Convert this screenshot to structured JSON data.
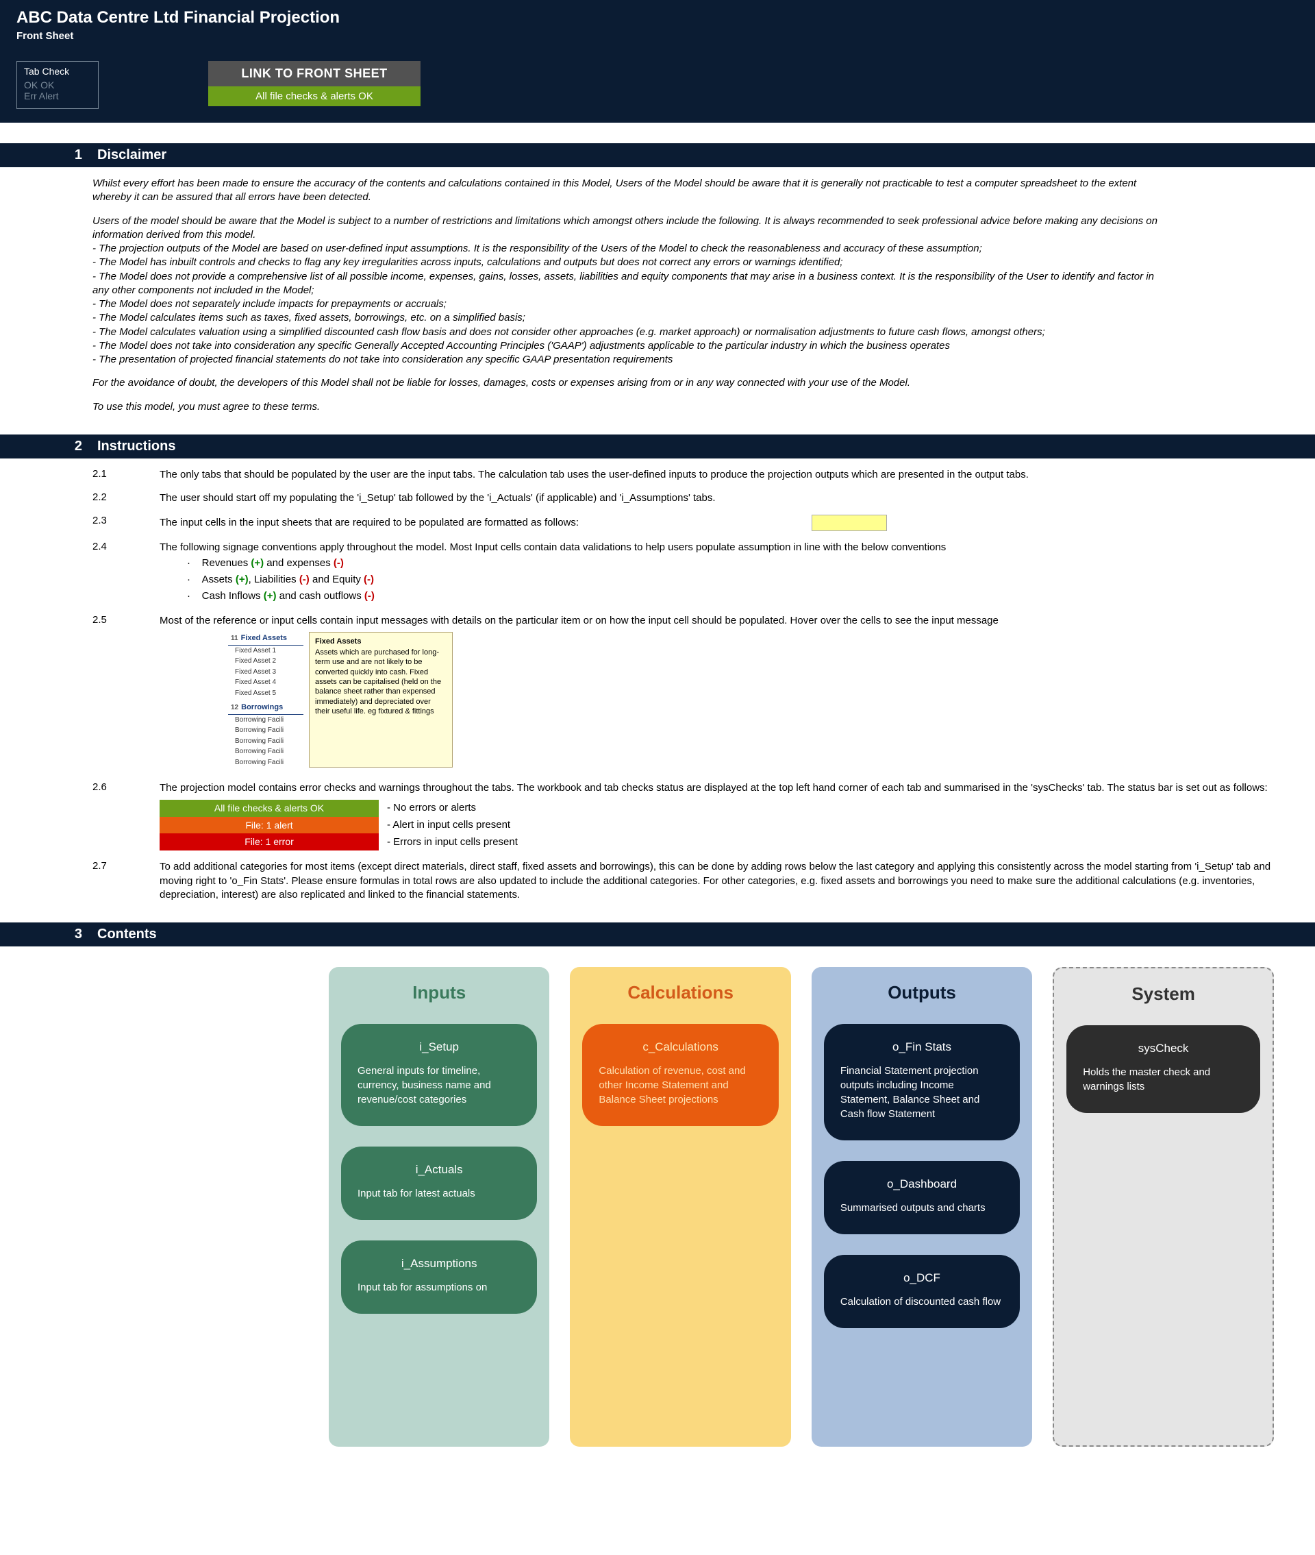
{
  "header": {
    "title": "ABC Data Centre Ltd Financial Projection",
    "subtitle": "Front Sheet",
    "tab_check": {
      "label": "Tab Check",
      "row1": "OK   OK",
      "row2": "Err   Alert"
    },
    "link_button": "LINK TO FRONT SHEET",
    "status_bar": "All file checks & alerts OK"
  },
  "sections": {
    "s1_num": "1",
    "s1_title": "Disclaimer",
    "s2_num": "2",
    "s2_title": "Instructions",
    "s3_num": "3",
    "s3_title": "Contents"
  },
  "disclaimer": {
    "p1": "Whilst every effort has been made to ensure the accuracy of the contents and calculations contained in this Model, Users of the Model should be aware that it is generally not practicable to test a computer spreadsheet to the extent whereby it can be assured that all errors have been detected.",
    "p2": "Users of the model should be aware that the Model is subject to a number of restrictions and limitations which amongst others include the following. It is always recommended to seek professional advice before making any decisions on information derived from this model.",
    "b1": "- The projection outputs of the Model are based on user-defined input assumptions. It is the responsibility of the Users of the Model to check the reasonableness and accuracy of these assumption;",
    "b2": "- The Model has inbuilt controls and checks to flag any key irregularities across inputs, calculations and outputs but does not correct any errors or warnings identified;",
    "b3": "- The Model does not provide a comprehensive list of all possible income, expenses, gains, losses, assets, liabilities and equity components that may arise in a business context. It is the responsibility of the User to identify and factor in any other components not included in the Model;",
    "b4": "- The Model does not separately include impacts for prepayments or accruals;",
    "b5": "- The Model calculates items such as taxes, fixed assets, borrowings, etc. on a simplified basis;",
    "b6": "- The Model calculates valuation using a simplified discounted cash flow basis and does not consider other approaches (e.g. market approach) or normalisation adjustments to future cash flows, amongst others;",
    "b7": "- The Model does not take into consideration any specific Generally Accepted Accounting Principles ('GAAP') adjustments applicable to the particular industry in which the business operates",
    "b8": "- The presentation of projected financial statements do not take into consideration any specific GAAP presentation requirements",
    "p3": "For the avoidance of doubt, the developers of this Model shall not be liable for losses, damages, costs or expenses arising from or in any way connected with your use of the Model.",
    "p4": "To use this model, you must agree to these terms."
  },
  "instructions": {
    "i21_num": "2.1",
    "i21": "The only tabs that should be populated by the user are the input tabs. The calculation tab uses the user-defined inputs to produce the projection outputs which are presented in the output tabs.",
    "i22_num": "2.2",
    "i22": "The user should start off my populating the 'i_Setup' tab followed by the 'i_Actuals' (if applicable) and 'i_Assumptions' tabs.",
    "i23_num": "2.3",
    "i23": "The input cells in the input sheets that are required to be populated are formatted as follows:",
    "i24_num": "2.4",
    "i24": "The following signage conventions apply throughout the model. Most Input cells contain data validations to help users populate assumption in line with the below conventions",
    "i24_sub1_a": "Revenues ",
    "i24_sub1_b": " and expenses ",
    "i24_sub2_a": "Assets ",
    "i24_sub2_b": ", Liabilities ",
    "i24_sub2_c": " and Equity ",
    "i24_sub3_a": "Cash Inflows ",
    "i24_sub3_b": " and cash outflows ",
    "plus": "(+)",
    "minus": "(-)",
    "i25_num": "2.5",
    "i25": "Most of the reference or input cells contain input messages with details on the particular item or on how the input cell should be populated. Hover over the cells to see the input message",
    "i26_num": "2.6",
    "i26": "The projection model contains error checks and warnings throughout the tabs. The workbook and tab checks status are displayed at the top left hand corner of each tab and summarised in the 'sysChecks' tab. The status bar is set out as follows:",
    "i27_num": "2.7",
    "i27": "To add additional categories for most items (except direct materials, direct staff, fixed assets and borrowings), this can be done by adding rows below the last category and applying this consistently across the model starting from 'i_Setup' tab and moving right to 'o_Fin Stats'. Please ensure formulas in total rows are also updated to include the additional categories. For other categories, e.g. fixed assets and borrowings you need to make sure the additional calculations (e.g. inventories, depreciation, interest) are also replicated and linked to the financial statements."
  },
  "example_tooltip": {
    "row_num": "11",
    "header1": "Fixed Assets",
    "items1": [
      "Fixed Asset 1",
      "Fixed Asset 2",
      "Fixed Asset 3",
      "Fixed Asset 4",
      "Fixed Asset 5"
    ],
    "row_num2": "12",
    "header2": "Borrowings",
    "items2": [
      "Borrowing Facili",
      "Borrowing Facili",
      "Borrowing Facili",
      "Borrowing Facili",
      "Borrowing Facili"
    ],
    "tip_title": "Fixed Assets",
    "tip_body": "Assets which are purchased for long-term use and are not likely to be converted quickly into cash. Fixed assets can be capitalised (held on the balance sheet rather than expensed immediately) and depreciated over their useful life. eg fixtured & fittings"
  },
  "status_bars": {
    "green_text": "All file checks & alerts OK",
    "green_label": "- No errors or alerts",
    "orange_text": "File: 1 alert",
    "orange_label": "- Alert in input cells present",
    "red_text": "File: 1 error",
    "red_label": "- Errors in input cells present"
  },
  "contents": {
    "inputs": {
      "title": "Inputs",
      "cards": [
        {
          "title": "i_Setup",
          "desc": "General inputs for timeline, currency, business name and revenue/cost categories"
        },
        {
          "title": "i_Actuals",
          "desc": "Input tab for latest actuals"
        },
        {
          "title": "i_Assumptions",
          "desc": "Input tab for assumptions on"
        }
      ]
    },
    "calc": {
      "title": "Calculations",
      "cards": [
        {
          "title": "c_Calculations",
          "desc": "Calculation of revenue, cost and other Income Statement and Balance Sheet projections"
        }
      ]
    },
    "outputs": {
      "title": "Outputs",
      "cards": [
        {
          "title": "o_Fin Stats",
          "desc": "Financial Statement projection outputs including Income Statement, Balance Sheet and Cash flow Statement"
        },
        {
          "title": "o_Dashboard",
          "desc": "Summarised outputs and charts"
        },
        {
          "title": "o_DCF",
          "desc": "Calculation of discounted cash flow"
        }
      ]
    },
    "system": {
      "title": "System",
      "cards": [
        {
          "title": "sysCheck",
          "desc": "Holds the master check and warnings lists"
        }
      ]
    }
  }
}
